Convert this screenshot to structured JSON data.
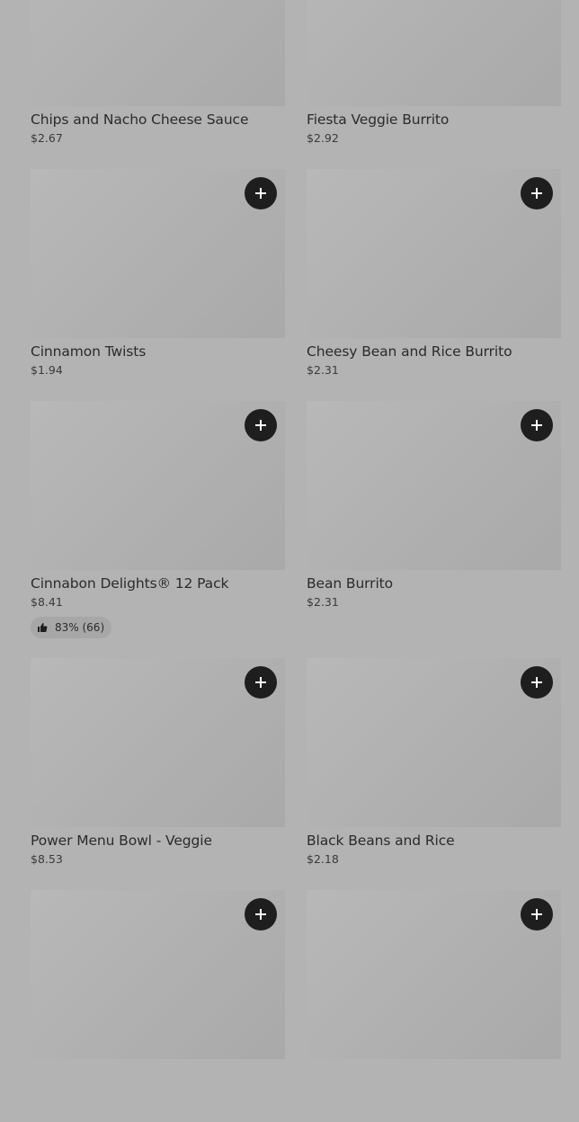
{
  "colors": {
    "background": "#b3b3b3",
    "add_button": "#1e1e1e",
    "add_button_icon": "#ffffff",
    "rating_chip": "#a7a7a7"
  },
  "menu": {
    "items": [
      {
        "name": "Chips and Nacho Cheese Sauce",
        "price": "$2.67"
      },
      {
        "name": "Fiesta Veggie Burrito",
        "price": "$2.92"
      },
      {
        "name": "Cinnamon Twists",
        "price": "$1.94"
      },
      {
        "name": "Cheesy Bean and Rice Burrito",
        "price": "$2.31"
      },
      {
        "name": "Cinnabon Delights® 12 Pack",
        "price": "$8.41",
        "rating": "83% (66)"
      },
      {
        "name": "Bean Burrito",
        "price": "$2.31"
      },
      {
        "name": "Power Menu Bowl - Veggie",
        "price": "$8.53"
      },
      {
        "name": "Black Beans and Rice",
        "price": "$2.18"
      },
      {
        "name": "",
        "price": ""
      },
      {
        "name": "",
        "price": ""
      }
    ]
  },
  "icons": {
    "add": "plus-icon",
    "rating": "thumbs-up-icon"
  }
}
